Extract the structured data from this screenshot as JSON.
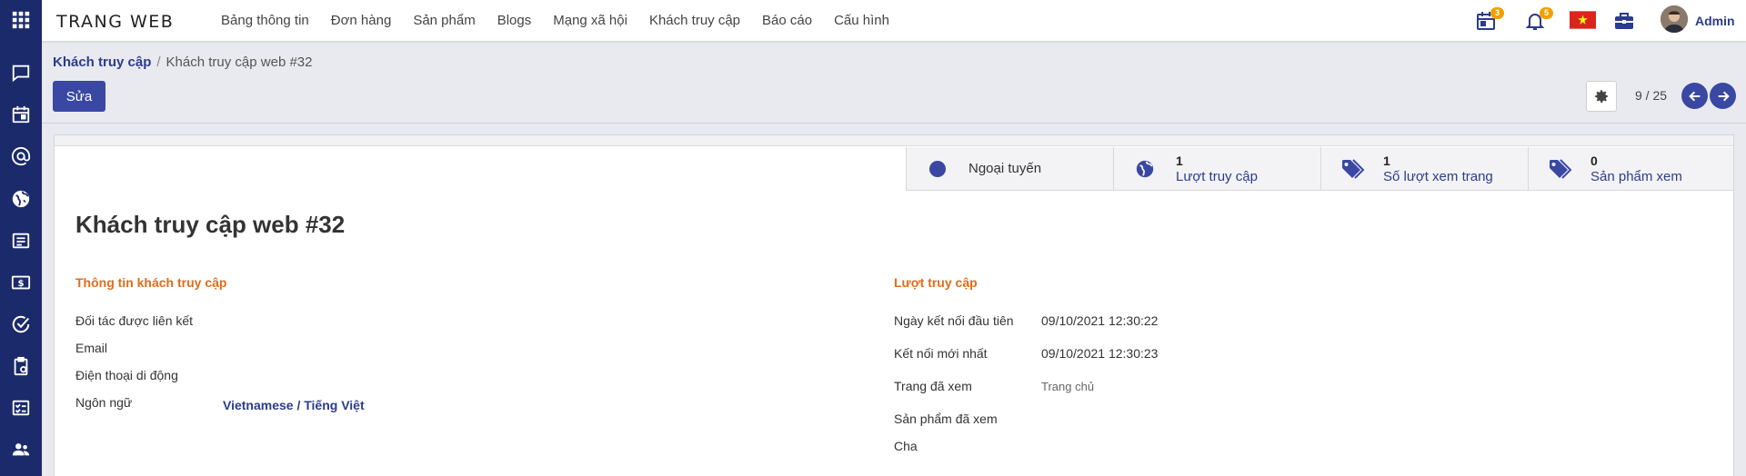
{
  "app": {
    "brand": "TRANG WEB",
    "menu": [
      "Bảng thông tin",
      "Đơn hàng",
      "Sản phẩm",
      "Blogs",
      "Mạng xã hội",
      "Khách truy cập",
      "Báo cáo",
      "Cấu hình"
    ],
    "activity_badge": "3",
    "notification_badge": "5",
    "user_name": "Admin"
  },
  "sidebar_icons": [
    "chat-icon",
    "calendar-icon",
    "at-sign-icon",
    "globe-icon",
    "newspaper-icon",
    "invoice-dollar-icon",
    "task-check-icon",
    "clipboard-icon",
    "checklist-icon",
    "users-icon"
  ],
  "breadcrumb": {
    "parent": "Khách truy cập",
    "separator": "/",
    "current": "Khách truy cập web #32"
  },
  "controls": {
    "edit_label": "Sửa",
    "pager": "9 / 25"
  },
  "stats": {
    "status_label": "Ngoại tuyến",
    "visits_count": "1",
    "visits_label": "Lượt truy cập",
    "pageviews_count": "1",
    "pageviews_label": "Số lượt xem trang",
    "products_count": "0",
    "products_label": "Sản phẩm xem"
  },
  "form": {
    "title": "Khách truy cập web #32",
    "left_group": {
      "title": "Thông tin khách truy cập",
      "partner_label": "Đối tác được liên kết",
      "email_label": "Email",
      "mobile_label": "Điện thoại di động",
      "language_label": "Ngôn ngữ",
      "language_value": "Vietnamese / Tiếng Việt"
    },
    "right_group": {
      "title": "Lượt truy cập",
      "first_connection_label": "Ngày kết nối đầu tiên",
      "first_connection_value": "09/10/2021 12:30:22",
      "last_connection_label": "Kết nối mới nhất",
      "last_connection_value": "09/10/2021 12:30:23",
      "pages_label": "Trang đã xem",
      "pages_value": "Trang chủ",
      "products_label": "Sản phẩm đã xem",
      "parent_label": "Cha"
    }
  },
  "colors": {
    "rail": "#1b2a6b",
    "primary": "#3a48a4",
    "group_title": "#e06c1a",
    "link": "#2c3c8c",
    "badge": "#f0a000"
  }
}
